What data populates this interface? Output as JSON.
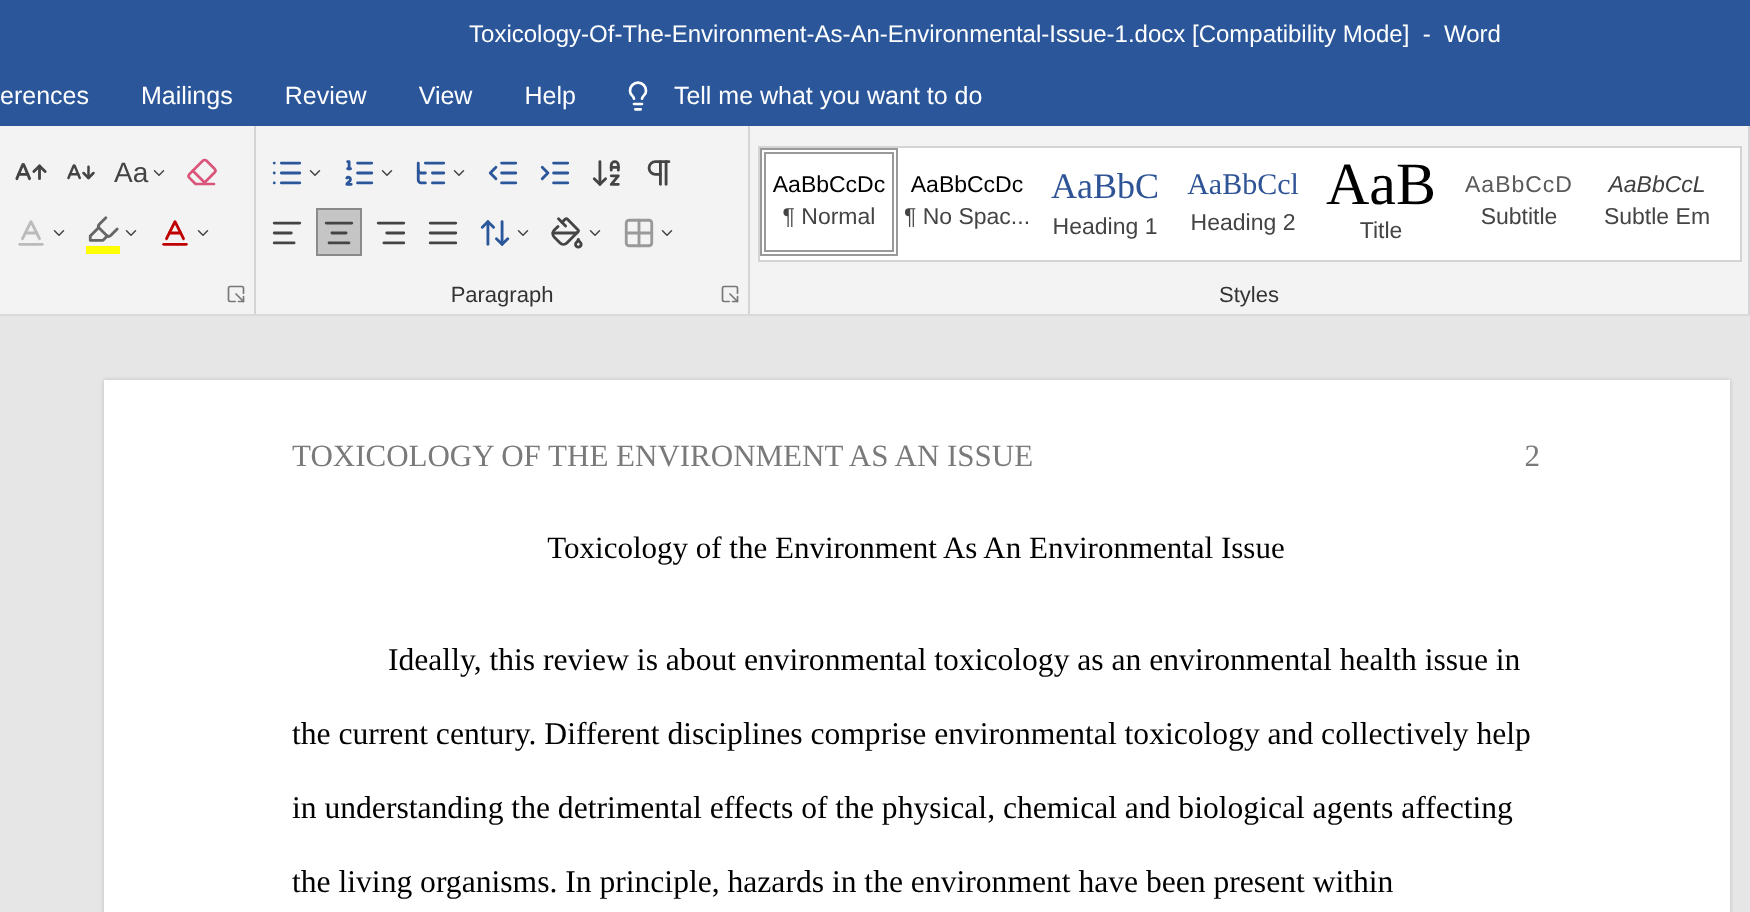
{
  "window": {
    "title": "Toxicology-Of-The-Environment-As-An-Environmental-Issue-1.docx [Compatibility Mode]  -  Word"
  },
  "tabs": [
    {
      "label": "erences",
      "selected": false
    },
    {
      "label": "Mailings",
      "selected": false
    },
    {
      "label": "Review",
      "selected": false
    },
    {
      "label": "View",
      "selected": false
    },
    {
      "label": "Help",
      "selected": false
    }
  ],
  "tell_me": {
    "placeholder": "Tell me what you want to do"
  },
  "font_group": {
    "case_button": "Aa"
  },
  "paragraph_group": {
    "label": "Paragraph",
    "alignment": [
      {
        "kind": "left",
        "selected": false
      },
      {
        "kind": "center",
        "selected": true
      },
      {
        "kind": "right",
        "selected": false
      },
      {
        "kind": "justify",
        "selected": false
      }
    ]
  },
  "styles_group": {
    "label": "Styles",
    "items": [
      {
        "sample": "AaBbCcDc",
        "name": "¶ Normal",
        "kind": "normal",
        "selected": true
      },
      {
        "sample": "AaBbCcDc",
        "name": "¶ No Spac...",
        "kind": "normal",
        "selected": false
      },
      {
        "sample": "AaBbC",
        "name": "Heading 1",
        "kind": "heading1",
        "selected": false
      },
      {
        "sample": "AaBbCcl",
        "name": "Heading 2",
        "kind": "heading2",
        "selected": false
      },
      {
        "sample": "AaB",
        "name": "Title",
        "kind": "title",
        "selected": false
      },
      {
        "sample": "AaBbCcD",
        "name": "Subtitle",
        "kind": "subtitle",
        "selected": false
      },
      {
        "sample": "AaBbCcL",
        "name": "Subtle Em",
        "kind": "emphasis",
        "selected": false
      }
    ]
  },
  "document": {
    "header": "TOXICOLOGY OF THE ENVIRONMENT AS AN ISSUE",
    "page_number": "2",
    "title": "Toxicology of the Environment As An Environmental Issue",
    "paragraph": "Ideally, this review is about environmental toxicology as an environmental health issue in the current century. Different disciplines comprise environmental toxicology and collectively help in understanding the detrimental effects of the physical, chemical and biological agents affecting the living organisms. In principle, hazards in the environment have been present within"
  }
}
